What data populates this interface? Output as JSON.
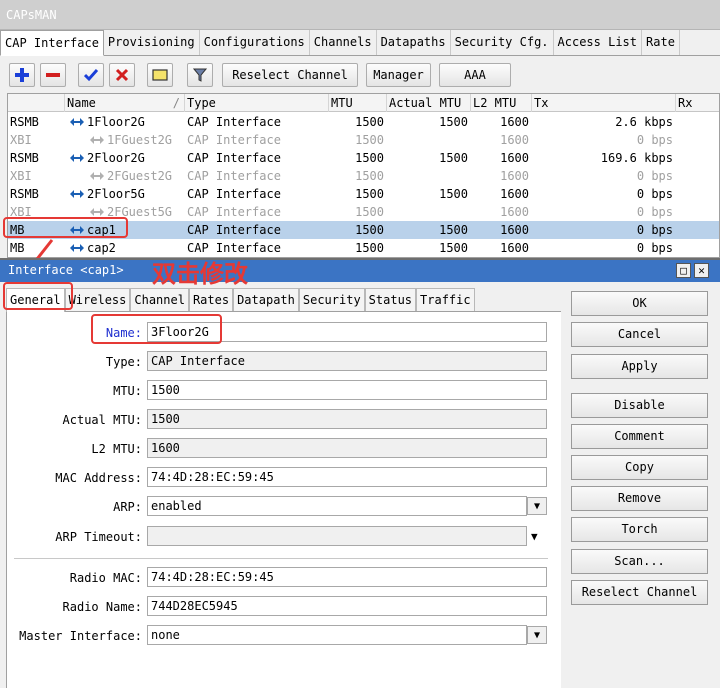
{
  "window": {
    "title": "CAPsMAN"
  },
  "tabs": [
    "CAP Interface",
    "Provisioning",
    "Configurations",
    "Channels",
    "Datapaths",
    "Security Cfg.",
    "Access List",
    "Rate"
  ],
  "toolbar": {
    "reselect_channel": "Reselect Channel",
    "manager": "Manager",
    "aaa": "AAA"
  },
  "table": {
    "headers": [
      "",
      "Name",
      "Type",
      "MTU",
      "Actual MTU",
      "L2 MTU",
      "Tx",
      "Rx"
    ],
    "rows": [
      {
        "flag": "RSMB",
        "name": "1Floor2G",
        "type": "CAP Interface",
        "mtu": "1500",
        "actual_mtu": "1500",
        "l2mtu": "1600",
        "tx": "2.6 kbps",
        "state": "normal",
        "indent": false
      },
      {
        "flag": "XBI",
        "name": "1FGuest2G",
        "type": "CAP Interface",
        "mtu": "1500",
        "actual_mtu": "",
        "l2mtu": "1600",
        "tx": "0 bps",
        "state": "disabled",
        "indent": true
      },
      {
        "flag": "RSMB",
        "name": "2Floor2G",
        "type": "CAP Interface",
        "mtu": "1500",
        "actual_mtu": "1500",
        "l2mtu": "1600",
        "tx": "169.6 kbps",
        "state": "normal",
        "indent": false
      },
      {
        "flag": "XBI",
        "name": "2FGuest2G",
        "type": "CAP Interface",
        "mtu": "1500",
        "actual_mtu": "",
        "l2mtu": "1600",
        "tx": "0 bps",
        "state": "disabled",
        "indent": true
      },
      {
        "flag": "RSMB",
        "name": "2Floor5G",
        "type": "CAP Interface",
        "mtu": "1500",
        "actual_mtu": "1500",
        "l2mtu": "1600",
        "tx": "0 bps",
        "state": "normal",
        "indent": false
      },
      {
        "flag": "XBI",
        "name": "2FGuest5G",
        "type": "CAP Interface",
        "mtu": "1500",
        "actual_mtu": "",
        "l2mtu": "1600",
        "tx": "0 bps",
        "state": "disabled",
        "indent": true
      },
      {
        "flag": "MB",
        "name": "cap1",
        "type": "CAP Interface",
        "mtu": "1500",
        "actual_mtu": "1500",
        "l2mtu": "1600",
        "tx": "0 bps",
        "state": "selected",
        "indent": false
      },
      {
        "flag": "MB",
        "name": "cap2",
        "type": "CAP Interface",
        "mtu": "1500",
        "actual_mtu": "1500",
        "l2mtu": "1600",
        "tx": "0 bps",
        "state": "normal",
        "indent": false
      }
    ]
  },
  "annotation": {
    "text": "双击修改",
    "color": "#e53935"
  },
  "dialog": {
    "title": "Interface <cap1>",
    "tabs": [
      "General",
      "Wireless",
      "Channel",
      "Rates",
      "Datapath",
      "Security",
      "Status",
      "Traffic"
    ],
    "fields": {
      "name": {
        "label": "Name:",
        "value": "3Floor2G"
      },
      "type": {
        "label": "Type:",
        "value": "CAP Interface"
      },
      "mtu": {
        "label": "MTU:",
        "value": "1500"
      },
      "actual_mtu": {
        "label": "Actual MTU:",
        "value": "1500"
      },
      "l2_mtu": {
        "label": "L2 MTU:",
        "value": "1600"
      },
      "mac_address": {
        "label": "MAC Address:",
        "value": "74:4D:28:EC:59:45"
      },
      "arp": {
        "label": "ARP:",
        "value": "enabled"
      },
      "arp_timeout": {
        "label": "ARP Timeout:",
        "value": ""
      },
      "radio_mac": {
        "label": "Radio MAC:",
        "value": "74:4D:28:EC:59:45"
      },
      "radio_name": {
        "label": "Radio Name:",
        "value": "744D28EC5945"
      },
      "master_interface": {
        "label": "Master Interface:",
        "value": "none"
      }
    },
    "buttons": [
      "OK",
      "Cancel",
      "Apply",
      "Disable",
      "Comment",
      "Copy",
      "Remove",
      "Torch",
      "Scan...",
      "Reselect Channel"
    ]
  },
  "colors": {
    "selection": "#b9d1ea",
    "dialog_title": "#3b74c4",
    "annotation": "#e53935",
    "name_label": "#1f2fd0"
  }
}
